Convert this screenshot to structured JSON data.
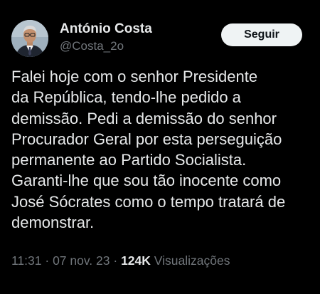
{
  "author": {
    "name": "António Costa",
    "handle": "@Costa_2o"
  },
  "follow_button": {
    "label": "Seguir"
  },
  "tweet": {
    "text": "Falei hoje com o senhor Presidente\nda República, tendo-lhe pedido a\ndemissão. Pedi a demissão do senhor\nProcurador Geral por esta perseguição\npermanente ao Partido Socialista.\nGaranti-lhe que sou tão inocente como\nJosé Sócrates como o tempo tratará de\ndemonstrar."
  },
  "meta": {
    "time": "11:31",
    "separator": " · ",
    "date": "07 nov. 23",
    "views_count": "124K",
    "views_label": "Visualizações"
  },
  "colors": {
    "background": "#000000",
    "primary_text": "#e7e9ea",
    "secondary_text": "#71767b",
    "button_bg": "#eff3f4",
    "button_text": "#0f1419"
  }
}
